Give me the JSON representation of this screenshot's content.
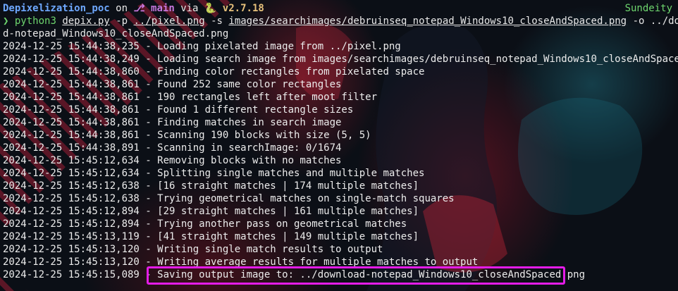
{
  "prompt": {
    "directory": "Depixelization_poc",
    "on_text": "on",
    "branch_icon": "git-branch-icon",
    "branch": "main",
    "via_text": "via",
    "python_icon": "python-snake-icon",
    "python_version": "v2.7.18",
    "user": "Sundeity"
  },
  "command": {
    "chevron": "❯",
    "program": "python3",
    "script": "depix.py",
    "flag_p": "-p",
    "pixel_path": "../pixel.png",
    "flag_s": "-s",
    "search_path": "images/searchimages/debruinseq_notepad_Windows10_closeAndSpaced.png",
    "flag_o": "-o",
    "output_part1": "../downloa",
    "output_part2": "d-notepad_Windows10_closeAndSpaced.png"
  },
  "log_lines": [
    "2024-12-25 15:44:38,235 - Loading pixelated image from ../pixel.png",
    "2024-12-25 15:44:38,249 - Loading search image from images/searchimages/debruinseq_notepad_Windows10_closeAndSpaced.png",
    "2024-12-25 15:44:38,860 - Finding color rectangles from pixelated space",
    "2024-12-25 15:44:38,861 - Found 252 same color rectangles",
    "2024-12-25 15:44:38,861 - 190 rectangles left after moot filter",
    "2024-12-25 15:44:38,861 - Found 1 different rectangle sizes",
    "2024-12-25 15:44:38,861 - Finding matches in search image",
    "2024-12-25 15:44:38,861 - Scanning 190 blocks with size (5, 5)",
    "2024-12-25 15:44:38,891 - Scanning in searchImage: 0/1674",
    "2024-12-25 15:45:12,634 - Removing blocks with no matches",
    "2024-12-25 15:45:12,634 - Splitting single matches and multiple matches",
    "2024-12-25 15:45:12,638 - [16 straight matches | 174 multiple matches]",
    "2024-12-25 15:45:12,638 - Trying geometrical matches on single-match squares",
    "2024-12-25 15:45:12,894 - [29 straight matches | 161 multiple matches]",
    "2024-12-25 15:45:12,894 - Trying another pass on geometrical matches",
    "2024-12-25 15:45:13,119 - [41 straight matches | 149 multiple matches]",
    "2024-12-25 15:45:13,120 - Writing single match results to output",
    "2024-12-25 15:45:13,120 - Writing average results for multiple matches to output",
    "2024-12-25 15:45:15,089 - Saving output image to: ../download-notepad_Windows10_closeAndSpaced.png"
  ],
  "highlight_color": "#e41ce8"
}
